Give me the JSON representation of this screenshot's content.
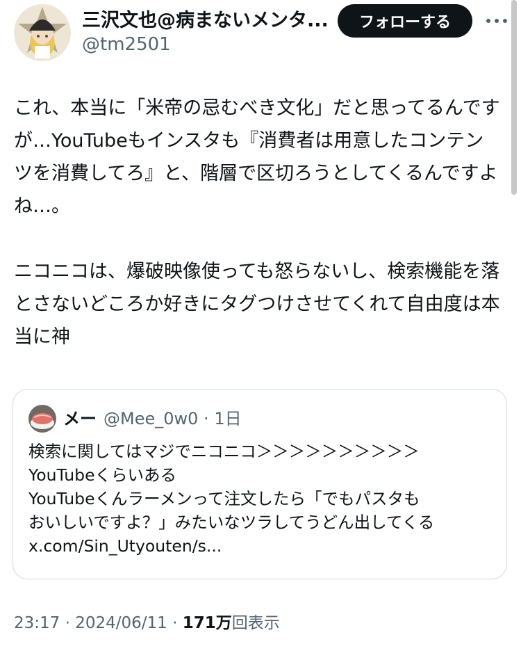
{
  "tweet": {
    "author": {
      "display_name": "三沢文也@病まないメンタ...",
      "handle": "@tm2501"
    },
    "follow_label": "フォローする",
    "more_icon": "more-horizontal-icon",
    "paragraphs": [
      "これ、本当に「米帝の忌むべき文化」だと思ってるんですが…YouTubeもインスタも『消費者は用意したコンテンツを消費してろ』と、階層で区切ろうとしてくるんですよね…。",
      "ニコニコは、爆破映像使っても怒らないし、検索機能を落とさないどころか好きにタグつけさせてくれて自由度は本当に神"
    ],
    "meta": {
      "time": "23:17",
      "separator": " · ",
      "date": "2024/06/11",
      "views_count": "171万",
      "views_label": "回表示"
    }
  },
  "quote": {
    "display_name": "メー",
    "handle": "@Mee_0w0",
    "separator": "·",
    "age": "1日",
    "lines": [
      "検索に関してはマジでニコニコ＞＞＞＞＞＞＞＞＞＞",
      "YouTubeくらいある",
      "YouTubeくんラーメンって注文したら「でもパスタも",
      "おいしいですよ？」みたいなツラしてうどん出してくる",
      "x.com/Sin_Utyouten/s..."
    ]
  },
  "colors": {
    "text_primary": "#0f1419",
    "text_secondary": "#536471",
    "border": "#cfd9de",
    "button_bg": "#0f1419",
    "button_text": "#ffffff"
  }
}
